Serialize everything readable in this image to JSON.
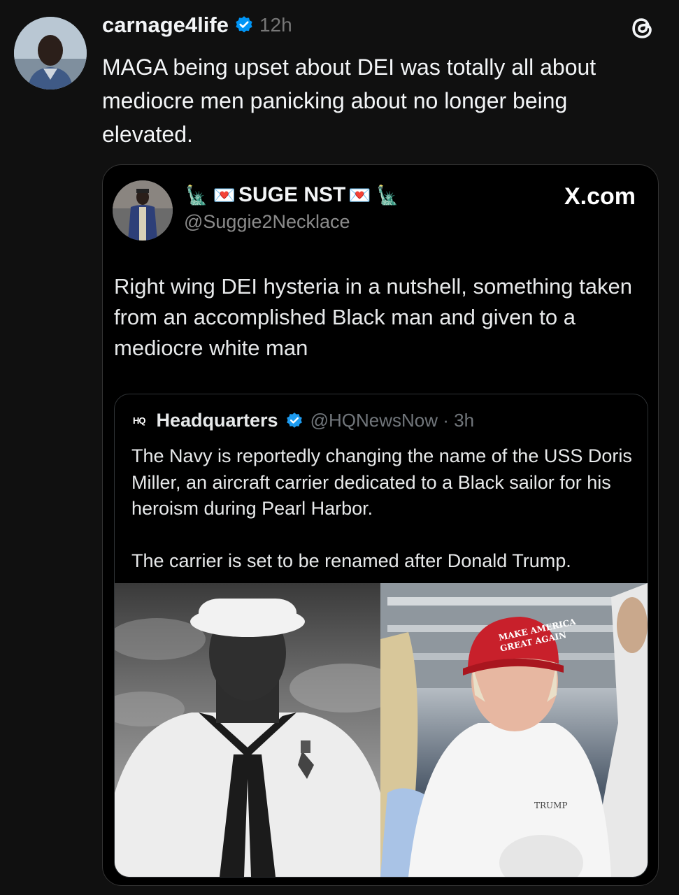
{
  "post": {
    "username": "carnage4life",
    "time": "12h",
    "text": "MAGA being upset about DEI was totally all about mediocre men panicking about no longer being elevated."
  },
  "embed": {
    "display_name": "SUGE NST",
    "emoji_left": "🗽 💌",
    "emoji_right": "💌 🗽",
    "handle": "@Suggie2Necklace",
    "source": "X.com",
    "text": "Right wing DEI hysteria in a nutshell, something taken from an accomplished Black man and given to a mediocre white man"
  },
  "quote": {
    "logo": "HQ",
    "name": "Headquarters",
    "handle_time": "@HQNewsNow · 3h",
    "text": "The Navy is reportedly changing the name of the USS Doris Miller, an aircraft carrier dedicated to a Black sailor for his heroism during Pearl Harbor.\n\nThe carrier is set to be renamed after Donald Trump.",
    "photo_right_hat_text_1": "MAKE AMERICA",
    "photo_right_hat_text_2": "GREAT AGAIN",
    "photo_right_shirt_text": "TRUMP"
  },
  "colors": {
    "background": "#101010",
    "verified_blue": "#0095f6",
    "hat_red": "#c8202b"
  },
  "icons": [
    "verified-badge-icon",
    "threads-logo-icon",
    "hq-logo-icon"
  ]
}
